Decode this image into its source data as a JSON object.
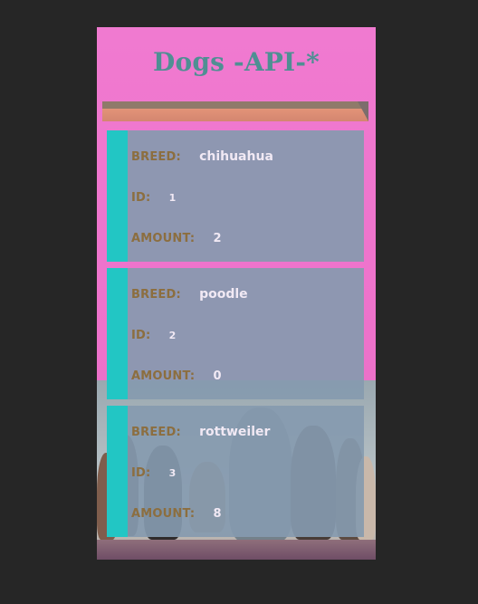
{
  "app": {
    "title": "Dogs -API-*"
  },
  "labels": {
    "breed": "BREED:",
    "id": "ID:",
    "amount": "AMOUNT:"
  },
  "dogs": [
    {
      "breed": "chihuahua",
      "id": "1",
      "amount": "2"
    },
    {
      "breed": "poodle",
      "id": "2",
      "amount": "0"
    },
    {
      "breed": "rottweiler",
      "id": "3",
      "amount": "8"
    }
  ]
}
